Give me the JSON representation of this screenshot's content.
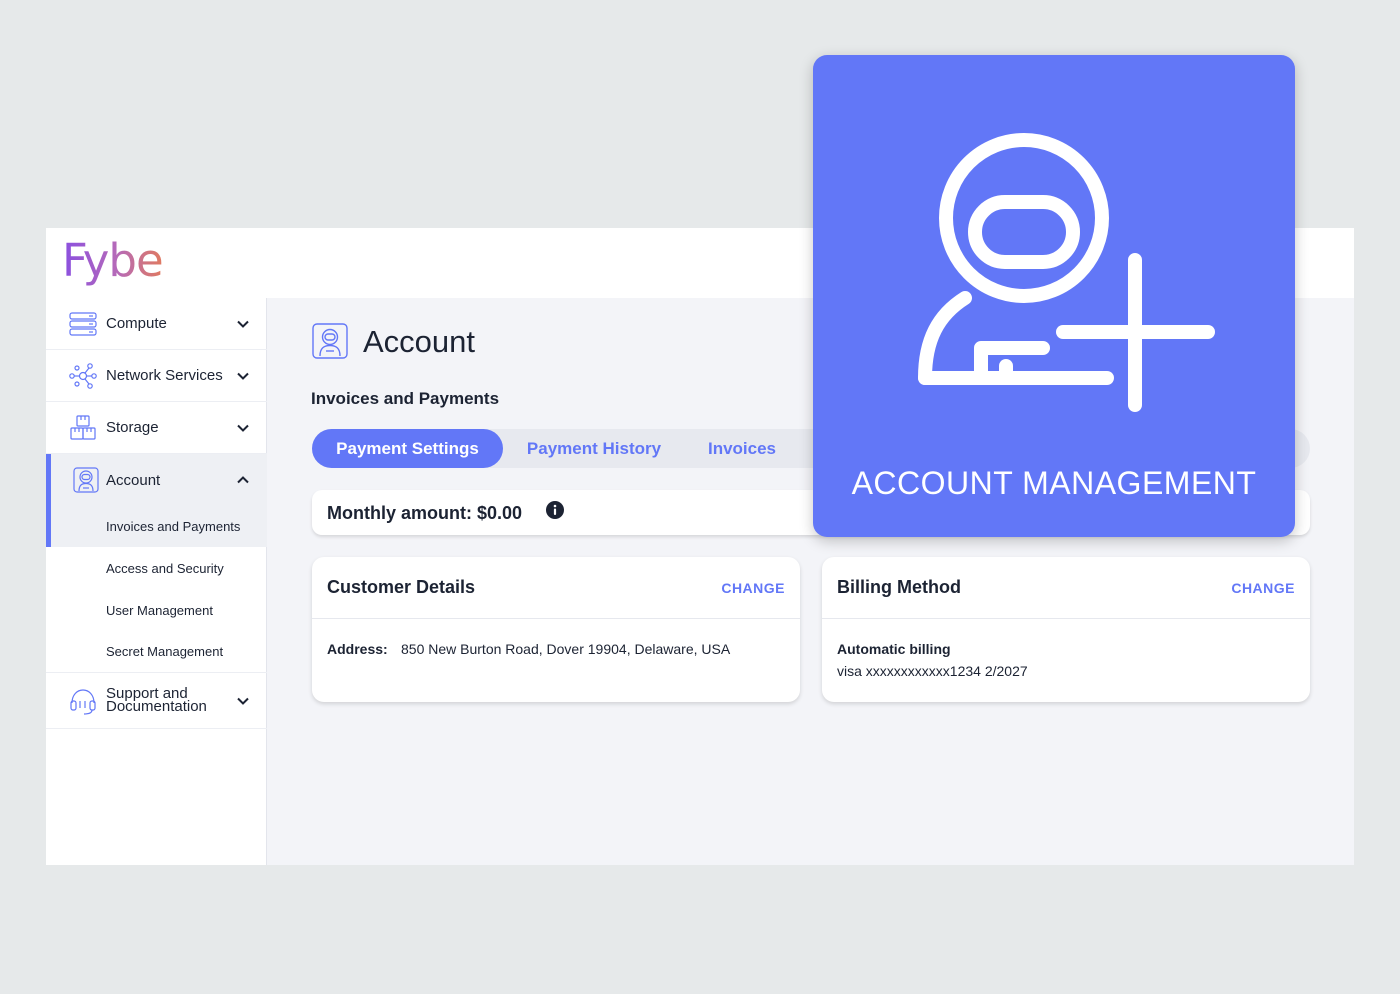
{
  "brand": {
    "logo": "Fybe"
  },
  "sidebar": {
    "items": [
      {
        "label": "Compute",
        "icon": "server-icon",
        "expanded": false
      },
      {
        "label": "Network Services",
        "icon": "network-icon",
        "expanded": false
      },
      {
        "label": "Storage",
        "icon": "storage-boxes-icon",
        "expanded": false
      },
      {
        "label": "Account",
        "icon": "astronaut-icon",
        "expanded": true
      },
      {
        "label": "Support and Documentation",
        "icon": "headset-icon",
        "expanded": false
      }
    ],
    "account_subitems": [
      {
        "label": "Invoices and Payments",
        "active": true
      },
      {
        "label": "Access and Security",
        "active": false
      },
      {
        "label": "User Management",
        "active": false
      },
      {
        "label": "Secret Management",
        "active": false
      }
    ]
  },
  "main": {
    "title": "Account",
    "section": "Invoices and Payments",
    "tabs": [
      {
        "label": "Payment Settings",
        "active": true
      },
      {
        "label": "Payment History",
        "active": false
      },
      {
        "label": "Invoices",
        "active": false
      }
    ],
    "monthly_amount": "Monthly amount: $0.00",
    "customer_card": {
      "title": "Customer Details",
      "action": "CHANGE",
      "address_label": "Address:",
      "address_value": "850 New Burton Road, Dover 19904, Delaware, USA"
    },
    "billing_card": {
      "title": "Billing Method",
      "action": "CHANGE",
      "method": "Automatic billing",
      "card": "visa xxxxxxxxxxxx1234 2/2027"
    }
  },
  "overlay": {
    "caption": "ACCOUNT MANAGEMENT",
    "icon": "add-user-astronaut-icon"
  },
  "colors": {
    "accent": "#6277f7",
    "text": "#1c2333",
    "page_bg": "#e6e9ea",
    "content_bg": "#f3f4f8"
  }
}
